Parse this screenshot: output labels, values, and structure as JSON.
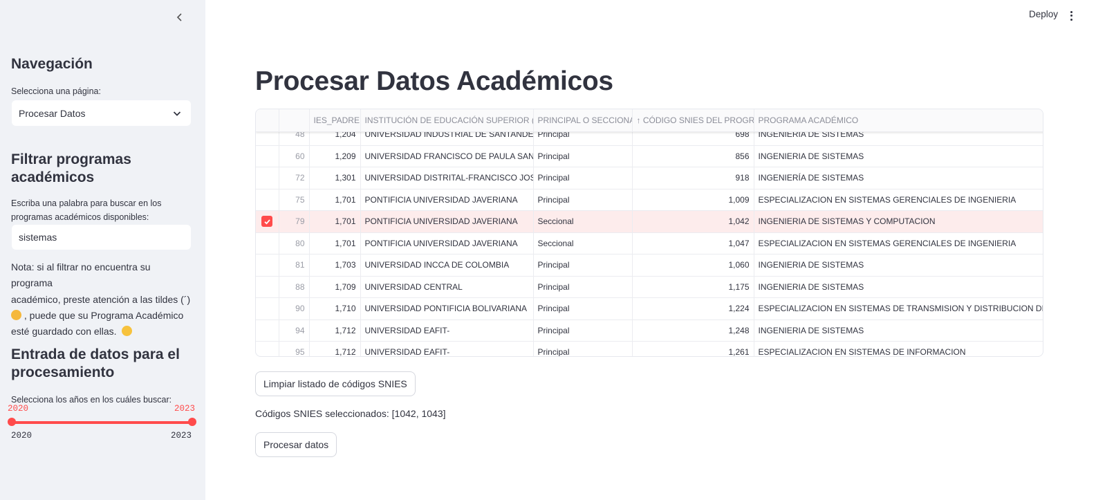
{
  "sidebar": {
    "nav_heading": "Navegación",
    "nav_label": "Selecciona una página:",
    "nav_selected": "Procesar Datos",
    "filter_heading_line1": "Filtrar programas",
    "filter_heading_line2": "académicos",
    "filter_label_line1": "Escriba una palabra para buscar en los",
    "filter_label_line2": "programas académicos disponibles:",
    "filter_value": "sistemas",
    "note_line1": "Nota: si al filtrar no encuentra su programa",
    "note_line2": "académico, preste atención a las tildes (´)",
    "note_line3": ", puede que su Programa Académico",
    "note_line4": "esté guardado con ellas.",
    "data_heading_line1": "Entrada de datos para el",
    "data_heading_line2": "procesamiento",
    "years_label": "Selecciona los años en los cuáles buscar:",
    "slider": {
      "min": "2020",
      "max": "2023",
      "value_low": "2020",
      "value_high": "2023"
    }
  },
  "header": {
    "deploy_label": "Deploy"
  },
  "main": {
    "title": "Procesar Datos Académicos",
    "table": {
      "columns": [
        "IES_PADRE",
        "INSTITUCIÓN DE EDUCACIÓN SUPERIOR (IES)",
        "PRINCIPAL O SECCIONAL",
        "↑ CÓDIGO SNIES DEL PROGRAMA",
        "PROGRAMA ACADÉMICO"
      ],
      "rows": [
        {
          "selected": false,
          "idx": "48",
          "ies_padre": "1,204",
          "institucion": "UNIVERSIDAD INDUSTRIAL DE SANTANDER",
          "tipo": "Principal",
          "snies": "698",
          "programa": "INGENIERIA DE SISTEMAS"
        },
        {
          "selected": false,
          "idx": "60",
          "ies_padre": "1,209",
          "institucion": "UNIVERSIDAD FRANCISCO DE PAULA SANTANDER",
          "tipo": "Principal",
          "snies": "856",
          "programa": "INGENIERIA DE SISTEMAS"
        },
        {
          "selected": false,
          "idx": "72",
          "ies_padre": "1,301",
          "institucion": "UNIVERSIDAD DISTRITAL-FRANCISCO JOSE DE CALDAS",
          "tipo": "Principal",
          "snies": "918",
          "programa": "INGENIERÍA DE SISTEMAS"
        },
        {
          "selected": false,
          "idx": "75",
          "ies_padre": "1,701",
          "institucion": "PONTIFICIA UNIVERSIDAD JAVERIANA",
          "tipo": "Principal",
          "snies": "1,009",
          "programa": "ESPECIALIZACION EN SISTEMAS GERENCIALES DE INGENIERIA"
        },
        {
          "selected": true,
          "idx": "79",
          "ies_padre": "1,701",
          "institucion": "PONTIFICIA UNIVERSIDAD JAVERIANA",
          "tipo": "Seccional",
          "snies": "1,042",
          "programa": "INGENIERIA DE SISTEMAS Y COMPUTACION"
        },
        {
          "selected": false,
          "idx": "80",
          "ies_padre": "1,701",
          "institucion": "PONTIFICIA UNIVERSIDAD JAVERIANA",
          "tipo": "Seccional",
          "snies": "1,047",
          "programa": "ESPECIALIZACION EN SISTEMAS GERENCIALES DE INGENIERIA"
        },
        {
          "selected": false,
          "idx": "81",
          "ies_padre": "1,703",
          "institucion": "UNIVERSIDAD INCCA DE COLOMBIA",
          "tipo": "Principal",
          "snies": "1,060",
          "programa": "INGENIERIA DE SISTEMAS"
        },
        {
          "selected": false,
          "idx": "88",
          "ies_padre": "1,709",
          "institucion": "UNIVERSIDAD CENTRAL",
          "tipo": "Principal",
          "snies": "1,175",
          "programa": "INGENIERIA DE SISTEMAS"
        },
        {
          "selected": false,
          "idx": "90",
          "ies_padre": "1,710",
          "institucion": "UNIVERSIDAD PONTIFICIA BOLIVARIANA",
          "tipo": "Principal",
          "snies": "1,224",
          "programa": "ESPECIALIZACION EN SISTEMAS DE TRANSMISION Y DISTRIBUCION DE ENERGIA"
        },
        {
          "selected": false,
          "idx": "94",
          "ies_padre": "1,712",
          "institucion": "UNIVERSIDAD EAFIT-",
          "tipo": "Principal",
          "snies": "1,248",
          "programa": "INGENIERIA DE SISTEMAS"
        },
        {
          "selected": false,
          "idx": "95",
          "ies_padre": "1,712",
          "institucion": "UNIVERSIDAD EAFIT-",
          "tipo": "Principal",
          "snies": "1,261",
          "programa": "ESPECIALIZACION EN SISTEMAS DE INFORMACION"
        }
      ]
    },
    "clear_button": "Limpiar listado de códigos SNIES",
    "selected_codes_text": "Códigos SNIES seleccionados: [1042, 1043]",
    "process_button": "Procesar datos"
  },
  "colors": {
    "accent": "#ff4b4b",
    "sidebar_bg": "#f0f2f6",
    "selected_row": "#fdecec"
  },
  "icons": [
    "chevron-left-icon",
    "chevron-down-icon",
    "kebab-menu-icon",
    "nerd-face-emoji",
    "tongue-wink-emoji",
    "check-icon"
  ]
}
